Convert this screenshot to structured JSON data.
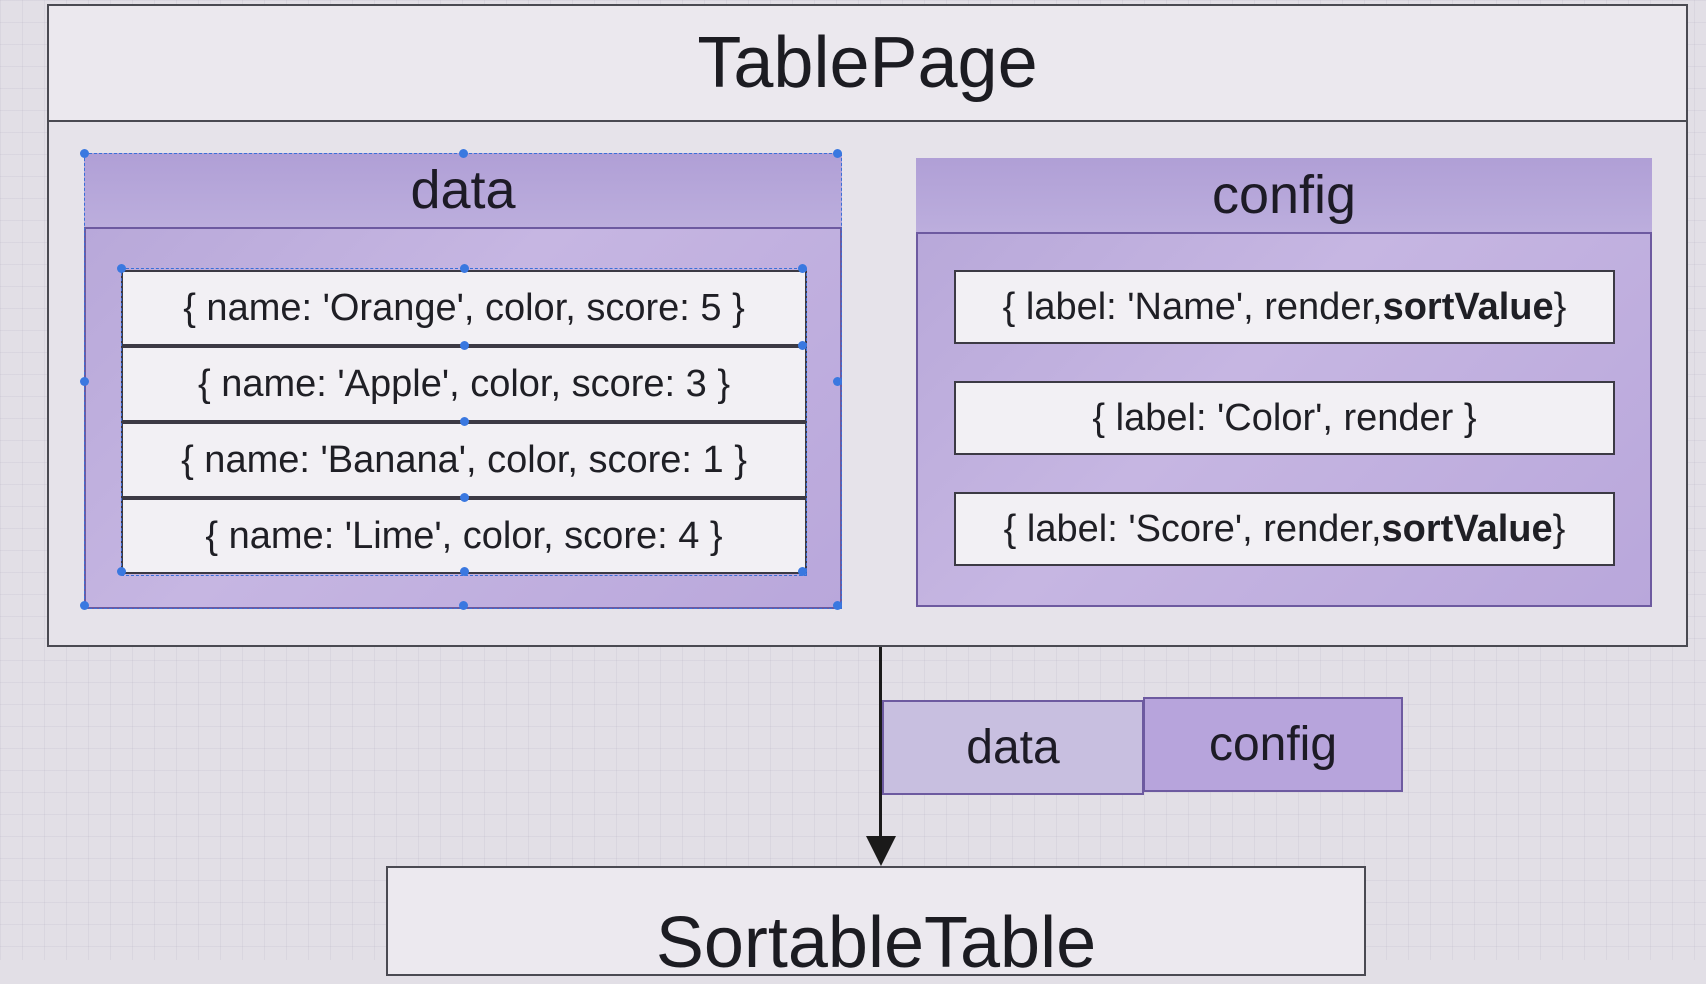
{
  "tablepage": {
    "title": "TablePage"
  },
  "data_panel": {
    "title": "data",
    "rows": [
      "{ name: 'Orange', color, score: 5 }",
      "{ name: 'Apple', color, score: 3 }",
      "{ name: 'Banana', color, score: 1 }",
      "{ name: 'Lime', color, score: 4 }"
    ]
  },
  "config_panel": {
    "title": "config",
    "rows": [
      {
        "prefix": "{ label: 'Name', render, ",
        "bold": "sortValue",
        "suffix": " }"
      },
      {
        "prefix": "{ label: 'Color', render }",
        "bold": "",
        "suffix": ""
      },
      {
        "prefix": "{ label: 'Score', render, ",
        "bold": "sortValue",
        "suffix": " }"
      }
    ]
  },
  "props": {
    "data_label": "data",
    "config_label": "config"
  },
  "sortable_table": {
    "title": "SortableTable"
  },
  "colors": {
    "panel_purple": "#b6a6d8",
    "panel_border": "#6d5aa0",
    "selection_blue": "#3a78e0"
  }
}
